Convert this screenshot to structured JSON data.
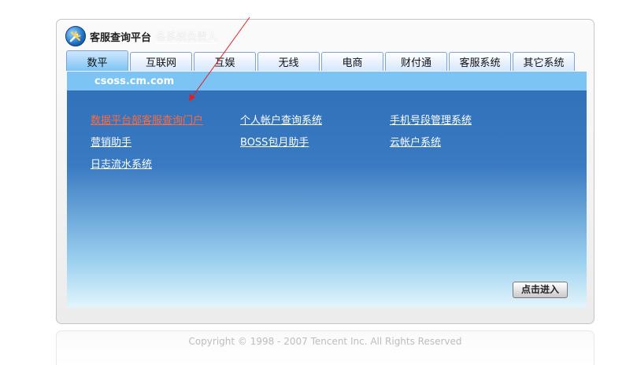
{
  "header": {
    "title": "客服查询平台",
    "subtitle": "各系统负责人"
  },
  "tabs": [
    {
      "label": "数平",
      "active": true
    },
    {
      "label": "互联网",
      "active": false
    },
    {
      "label": "互娱",
      "active": false
    },
    {
      "label": "无线",
      "active": false
    },
    {
      "label": "电商",
      "active": false
    },
    {
      "label": "财付通",
      "active": false
    },
    {
      "label": "客服系统",
      "active": false
    },
    {
      "label": "其它系统",
      "active": false
    }
  ],
  "content": {
    "domain": "csoss.cm.com",
    "links": [
      {
        "label": "数据平台部客服查询门户",
        "highlighted": true
      },
      {
        "label": "个人帐户查询系统",
        "highlighted": false
      },
      {
        "label": "手机号段管理系统",
        "highlighted": false
      },
      {
        "label": "营销助手",
        "highlighted": false
      },
      {
        "label": "BOSS包月助手",
        "highlighted": false
      },
      {
        "label": "云帐户系统",
        "highlighted": false
      },
      {
        "label": "日志流水系统",
        "highlighted": false
      }
    ],
    "enter_button": "点击进入"
  },
  "footer": {
    "copyright": "Copyright © 1998 - 2007 Tencent Inc. All Rights Reserved"
  },
  "colors": {
    "highlight_link": "#ff6a3d",
    "link": "#ffffff",
    "annotation_arrow": "#e02020"
  }
}
